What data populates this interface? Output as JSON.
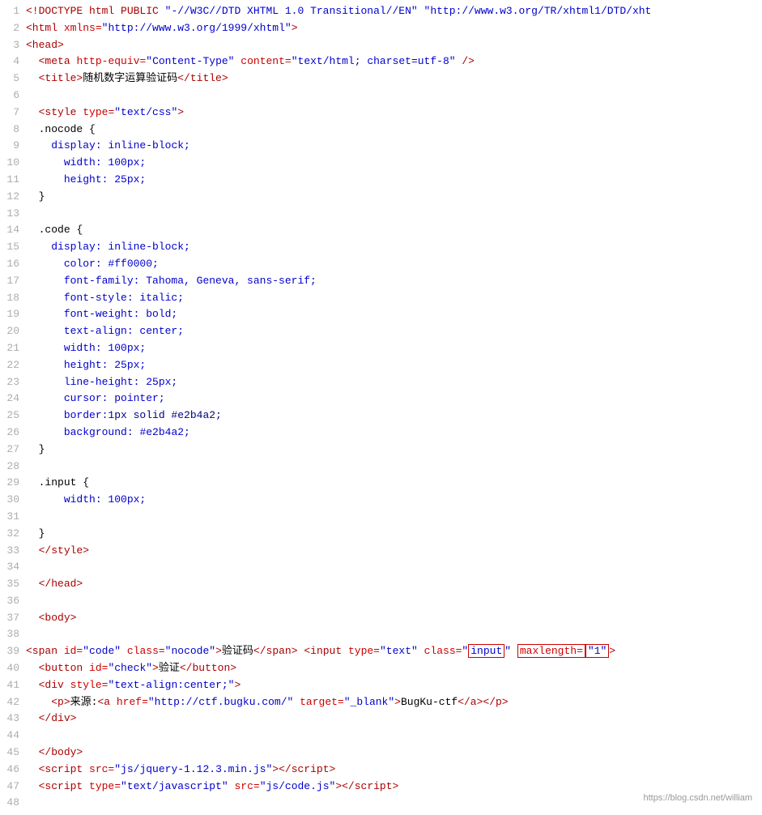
{
  "lines": [
    {
      "num": 1,
      "html": "<span class='tag'>&lt;!DOCTYPE html PUBLIC</span> <span class='attr-value'>\"-//W3C//DTD XHTML 1.0 Transitional//EN\"</span> <span class='attr-value'>\"http://www.w3.org/TR/xhtml1/DTD/xht</span>"
    },
    {
      "num": 2,
      "html": "<span class='tag'>&lt;html</span> <span class='attr-name'>xmlns=</span><span class='attr-value'>\"http://www.w3.org/1999/xhtml\"</span><span class='tag'>&gt;</span>"
    },
    {
      "num": 3,
      "html": "<span class='tag'>&lt;head&gt;</span>"
    },
    {
      "num": 4,
      "html": "  <span class='tag'>&lt;meta</span> <span class='attr-name'>http-equiv=</span><span class='attr-value'>\"Content-Type\"</span> <span class='attr-name'>content=</span><span class='attr-value'>\"text/html; charset=utf-8\"</span> <span class='tag'>/&gt;</span>"
    },
    {
      "num": 5,
      "html": "  <span class='tag'>&lt;title&gt;</span><span class='text-content'>随机数字运算验证码</span><span class='tag'>&lt;/title&gt;</span>"
    },
    {
      "num": 6,
      "html": ""
    },
    {
      "num": 7,
      "html": "  <span class='tag'>&lt;style</span> <span class='attr-name'>type=</span><span class='attr-value'>\"text/css\"</span><span class='tag'>&gt;</span>"
    },
    {
      "num": 8,
      "html": "  <span class='css-selector'>.nocode</span> <span class='text-content'>{</span>"
    },
    {
      "num": 9,
      "html": "    <span class='css-property'>display: inline-block;</span>"
    },
    {
      "num": 10,
      "html": "      <span class='css-property'>width: 100px;</span>"
    },
    {
      "num": 11,
      "html": "      <span class='css-property'>height: 25px;</span>"
    },
    {
      "num": 12,
      "html": "  <span class='text-content'>}</span>"
    },
    {
      "num": 13,
      "html": ""
    },
    {
      "num": 14,
      "html": "  <span class='css-selector'>.code</span> <span class='text-content'>{</span>"
    },
    {
      "num": 15,
      "html": "    <span class='css-property'>display: inline-block;</span>"
    },
    {
      "num": 16,
      "html": "      <span class='css-property'>color: </span><span class='css-color'>#ff0000;</span>"
    },
    {
      "num": 17,
      "html": "      <span class='css-property'>font-family: Tahoma, Geneva, sans-serif;</span>"
    },
    {
      "num": 18,
      "html": "      <span class='css-property'>font-style: italic;</span>"
    },
    {
      "num": 19,
      "html": "      <span class='css-property'>font-weight: bold;</span>"
    },
    {
      "num": 20,
      "html": "      <span class='css-property'>text-align: center;</span>"
    },
    {
      "num": 21,
      "html": "      <span class='css-property'>width: 100px;</span>"
    },
    {
      "num": 22,
      "html": "      <span class='css-property'>height: 25px;</span>"
    },
    {
      "num": 23,
      "html": "      <span class='css-property'>line-height: 25px;</span>"
    },
    {
      "num": 24,
      "html": "      <span class='css-property'>cursor: pointer;</span>"
    },
    {
      "num": 25,
      "html": "      <span class='css-property'>border:</span><span class='css-value'>1px solid #e2b4a2;</span>"
    },
    {
      "num": 26,
      "html": "      <span class='css-property'>background: </span><span class='css-color'>#e2b4a2;</span>"
    },
    {
      "num": 27,
      "html": "  <span class='text-content'>}</span>"
    },
    {
      "num": 28,
      "html": ""
    },
    {
      "num": 29,
      "html": "  <span class='css-selector'>.input</span> <span class='text-content'>{</span>"
    },
    {
      "num": 30,
      "html": "      <span class='css-property'>width: 100px;</span>"
    },
    {
      "num": 31,
      "html": ""
    },
    {
      "num": 32,
      "html": "  <span class='text-content'>}</span>"
    },
    {
      "num": 33,
      "html": "  <span class='tag'>&lt;/style&gt;</span>"
    },
    {
      "num": 34,
      "html": ""
    },
    {
      "num": 35,
      "html": "  <span class='tag'>&lt;/head&gt;</span>"
    },
    {
      "num": 36,
      "html": ""
    },
    {
      "num": 37,
      "html": "  <span class='tag'>&lt;body&gt;</span>"
    },
    {
      "num": 38,
      "html": ""
    },
    {
      "num": 39,
      "html": "<span class='tag'>&lt;span</span> <span class='attr-name'>id=</span><span class='attr-value'>\"code\"</span> <span class='attr-name'>class=</span><span class='attr-value'>\"nocode\"</span><span class='tag'>&gt;</span><span class='text-content'>验证码</span><span class='tag'>&lt;/span&gt;</span> <span class='tag'>&lt;input</span> <span class='attr-name'>type=</span><span class='attr-value'>\"text\"</span> <span class='attr-name'>class=</span><span class='attr-value'>\"<span class='highlight-box'>input</span>\"</span> <span class='attr-name highlight-box'>maxlength=</span><span class='attr-value highlight-box'>\"1\"</span><span class='tag'>&gt;</span>"
    },
    {
      "num": 40,
      "html": "  <span class='tag'>&lt;button</span> <span class='attr-name'>id=</span><span class='attr-value'>\"check\"</span><span class='tag'>&gt;</span><span class='text-content'>验证</span><span class='tag'>&lt;/button&gt;</span>"
    },
    {
      "num": 41,
      "html": "  <span class='tag'>&lt;div</span> <span class='attr-name'>style=</span><span class='attr-value'>\"text-align:center;\"</span><span class='tag'>&gt;</span>"
    },
    {
      "num": 42,
      "html": "    <span class='tag'>&lt;p&gt;</span><span class='text-content'>来源:</span><span class='tag'>&lt;a</span> <span class='attr-name'>href=</span><span class='attr-value'>\"http://ctf.bugku.com/\"</span> <span class='attr-name'>target=</span><span class='attr-value'>\"_blank\"</span><span class='tag'>&gt;</span><span class='text-content'>BugKu-ctf</span><span class='tag'>&lt;/a&gt;&lt;/p&gt;</span>"
    },
    {
      "num": 43,
      "html": "  <span class='tag'>&lt;/div&gt;</span>"
    },
    {
      "num": 44,
      "html": ""
    },
    {
      "num": 45,
      "html": "  <span class='tag'>&lt;/body&gt;</span>"
    },
    {
      "num": 46,
      "html": "  <span class='tag'>&lt;script</span> <span class='attr-name'>src=</span><span class='attr-value'>\"js/jquery-1.12.3.min.js\"</span><span class='tag'>&gt;&lt;/script&gt;</span>"
    },
    {
      "num": 47,
      "html": "  <span class='tag'>&lt;script</span> <span class='attr-name'>type=</span><span class='attr-value'>\"text/javascript\"</span> <span class='attr-name'>src=</span><span class='attr-value'>\"js/code.js\"</span><span class='tag'>&gt;&lt;/script&gt;</span>"
    },
    {
      "num": 48,
      "html": ""
    }
  ],
  "watermark": "https://blog.csdn.net/william"
}
